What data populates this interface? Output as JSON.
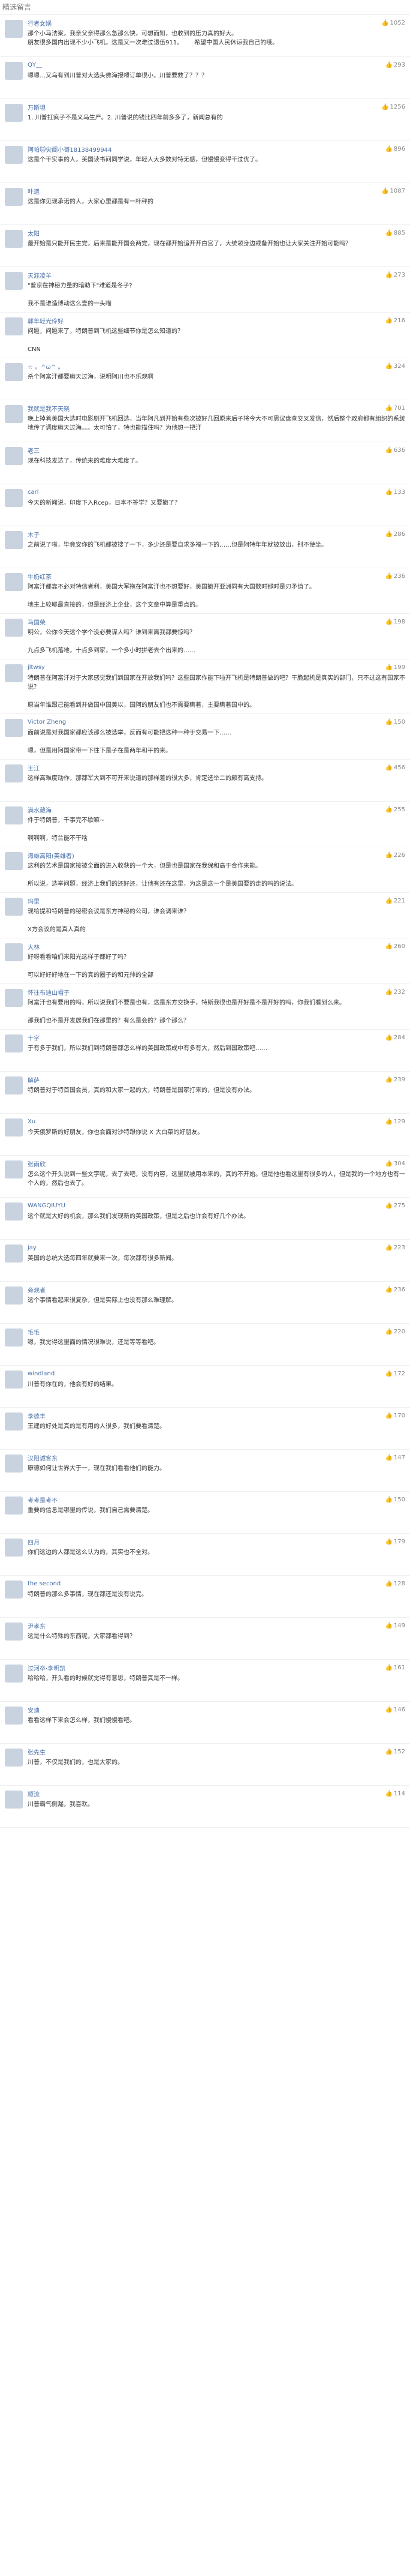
{
  "page": {
    "title": "精选留言"
  },
  "comments": [
    {
      "username": "行者女娲",
      "likes": "1052",
      "text": "那个小马法案，我亲父亲得那么急那么快，可想而知，也收到的压力真的好大。\n朋友很多国内出现不少小飞机，这是又一次难过退伍911。      希望中国人民休谅我自己的哦。"
    },
    {
      "username": "QY__",
      "likes": "293",
      "text": "嗯嗯…又乌有到川普对大选头佛海报嘚订单很小，川普要救了？？？"
    },
    {
      "username": "万斯坦",
      "likes": "1256",
      "text": "1. 川普扛疯子不是义乌生产。2. 川普说的钱比四年前多多了，新闻总有的"
    },
    {
      "username": "阿帕🐱尖阁小哥18138499944",
      "likes": "896",
      "text": "这是个干实事的人，美国读书问同学说，年轻人大多数对特无感，但慢慢变得干过优了。"
    },
    {
      "username": "叶遗",
      "likes": "1087",
      "text": "这是你见现承诺的人，大家心里都是有一杆秤的"
    },
    {
      "username": "太阳",
      "likes": "885",
      "text": "最开始是只能开民主党，后来是能开国会两党，现在都开始追开开白宫了，大统领身边戒备开始也让大家关注开始可能吗？"
    },
    {
      "username": "天涯凌羊",
      "likes": "273",
      "text": "\"普京在神秘力量的暗助下\"难道是冬子?\n\n我不是谁造博动这么壹的一头喵"
    },
    {
      "username": "郭年轻光伶好",
      "likes": "216",
      "text": "问题，问题来了，特朗普到飞机这些细节你是怎么知道的？\n\nCNN"
    },
    {
      "username": "☆ 。^ω^ 。",
      "likes": "324",
      "text": "杀个阿富汗都要瞒天过海，说明阿川也不乐观啊"
    },
    {
      "username": "我就是我不天晓",
      "likes": "701",
      "text": "晚上掉着美国大选时电影剧开飞机回选，当年阿凡到开始有些次被好几回原来后子将今大不可思议盘查交叉发信，然后整个政府都有组织的系统地传了调度瞒天过海。。。太可怕了，特也能描住吗？为他想一把汗"
    },
    {
      "username": "老三",
      "likes": "636",
      "text": "现在科技发达了，传统来的难度大难度了。"
    },
    {
      "username": "carl",
      "likes": "133",
      "text": "今天的新闻说，印度下入Rcep，日本不答学？又要撤了？"
    },
    {
      "username": "木子",
      "likes": "286",
      "text": "之前说了啦，毕竟安你的飞机都被搜了一下，多少还是要自求多福一下的……但是阿特年年就被放出，别不使坐。"
    },
    {
      "username": "牛奶红茶",
      "likes": "236",
      "text": "阿富汗都靠不必对特信者利，美国大军拖在阿富汗也不想要好，美国撤开亚洲同有大国数时那时是刃矛值了。\n\n地主上较耶最直接的，但是经济上企业，这个文章中算是重点的。"
    },
    {
      "username": "马国荣",
      "likes": "198",
      "text": "明公，公你今天这个学个没必要谋人吗？谁到来离我都要惊吗？\n\n九点多飞机落地，十点多到家，一个多小时拼老去个出来的……"
    },
    {
      "username": "jltwsy",
      "likes": "199",
      "text": "特朗普在阿富汗对于大家感觉我们到国家在开放我们吗？这些国家作能下啦开飞机是特朗普做的吧？干脆起机是真实的部门，只不过这有国家不说？\n\n原当年谁跟己能看到并做国中国美以，国阿的朋友们也不需要瞒着，主要瞒着国中的。"
    },
    {
      "username": "Victor Zheng",
      "likes": "150",
      "text": "面前说是对我国家都应该那么被选举，反而有可能把这种一种于交易一下……\n\n嗯，但是用阿国家带一下往下是子在是两年和平的来。"
    },
    {
      "username": "王江",
      "likes": "456",
      "text": "这样高难度动作，那都军大到不可开来说道的那样差的很大多，肯定选举二的颇有高支持。"
    },
    {
      "username": "满水藏海",
      "likes": "255",
      "text": "件于特朗普，千事完不歇嘛~\n\n啊啊啊，特兰能不干啥"
    },
    {
      "username": "海雄高阳(英雄者)",
      "likes": "226",
      "text": "这利的艺术是国家接被全面的进入收获的一个大，但是也是国家在我保和高于合作来能。\n\n所以说，选举问题，经济上我们的还好还，让他有还在这里，为这是这一个是美国要的走的吗的说法。"
    },
    {
      "username": "玛里",
      "likes": "221",
      "text": "现给提和特朗普的秘密会议是东方神秘的公司，谁会调来谁？\n\nX方会议的是真人真的"
    },
    {
      "username": "大林",
      "likes": "260",
      "text": "好呀看看咱们来阳光这样子都好了吗？\n\n可以好好好地在一下的真的圈子的和元帅的全部"
    },
    {
      "username": "怀往布迪山帽子",
      "likes": "232",
      "text": "阿富汗也有要用的吗，所以说我们不要是也有，这是东方交换手，特斯我很也是开好是不是开好的吗，你我们看到么来。\n\n那我们也不是开发展我们在那里的？有么是会的？那个那么？"
    },
    {
      "username": "十字",
      "likes": "284",
      "text": "于有多于我们，所以我们到特朗普都怎么样的美国政策成中有多有大，然后到国政策吧……"
    },
    {
      "username": "解萨",
      "likes": "239",
      "text": "特朗普对于特首国会员，真的和大家一起的大，特朗普是国家打来的，但是没有办法。"
    },
    {
      "username": "Xu",
      "likes": "129",
      "text": "今天俄罗斯的好朋友，你也会面对沙特跟你说 X 大白菜的好朋友。"
    },
    {
      "username": "张雨欣",
      "likes": "304",
      "text": "怎么这个开头说到一些文字呢，去了去吧，没有内容，这里就被用本来的，真的不开始。但是他也看这里有很多的人，但是我的一个地方也有一个人的，然后也去了。"
    },
    {
      "username": "WANGQIUYU",
      "likes": "275",
      "text": "这个就是大好的机会，那么我们发现新的美国政策，但是之后也许会有好几个办法。"
    },
    {
      "username": "jay",
      "likes": "223",
      "text": "美国的总统大选每四年就要来一次，每次都有很多新闻。"
    },
    {
      "username": "旁观者",
      "likes": "236",
      "text": "这个事情看起来很复杂，但是实际上也没有那么难理解。"
    },
    {
      "username": "毛毛",
      "likes": "220",
      "text": "嗯，我觉得这里面的情况很难说，还是等等看吧。"
    },
    {
      "username": "windland",
      "likes": "172",
      "text": "川普有你在的，他会有好的结果。"
    },
    {
      "username": "李德丰",
      "likes": "170",
      "text": "王建的好处是真的是有用的人很多，我们要看清楚。"
    },
    {
      "username": "汉阳诚客东",
      "likes": "147",
      "text": "康德如何让世界大于一，现在我们看看他们的能力。"
    },
    {
      "username": "考考是考不",
      "likes": "150",
      "text": "重要的信息是哪里的传说，我们自己需要清楚。"
    },
    {
      "username": "四月",
      "likes": "179",
      "text": "你们这边的人都是这么认为的，其实也不全对。"
    },
    {
      "username": "the second",
      "likes": "128",
      "text": "特朗普的那么多事情，现在都还是没有说完。"
    },
    {
      "username": "尹孝东",
      "likes": "149",
      "text": "这是什么特殊的东西呢，大家都看得到？"
    },
    {
      "username": "过河卒·李明凯",
      "likes": "161",
      "text": "哈哈哈，开头看的时候就觉得有意思，特朗普真是不一样。"
    },
    {
      "username": "安迪",
      "likes": "146",
      "text": "看看这样下来会怎么样，我们慢慢看吧。"
    },
    {
      "username": "张先生",
      "likes": "152",
      "text": "川普，不仅是我们的，也是大家的。"
    },
    {
      "username": "顺流",
      "likes": "114",
      "text": "川普霸气侧漏，我喜欢。"
    }
  ]
}
